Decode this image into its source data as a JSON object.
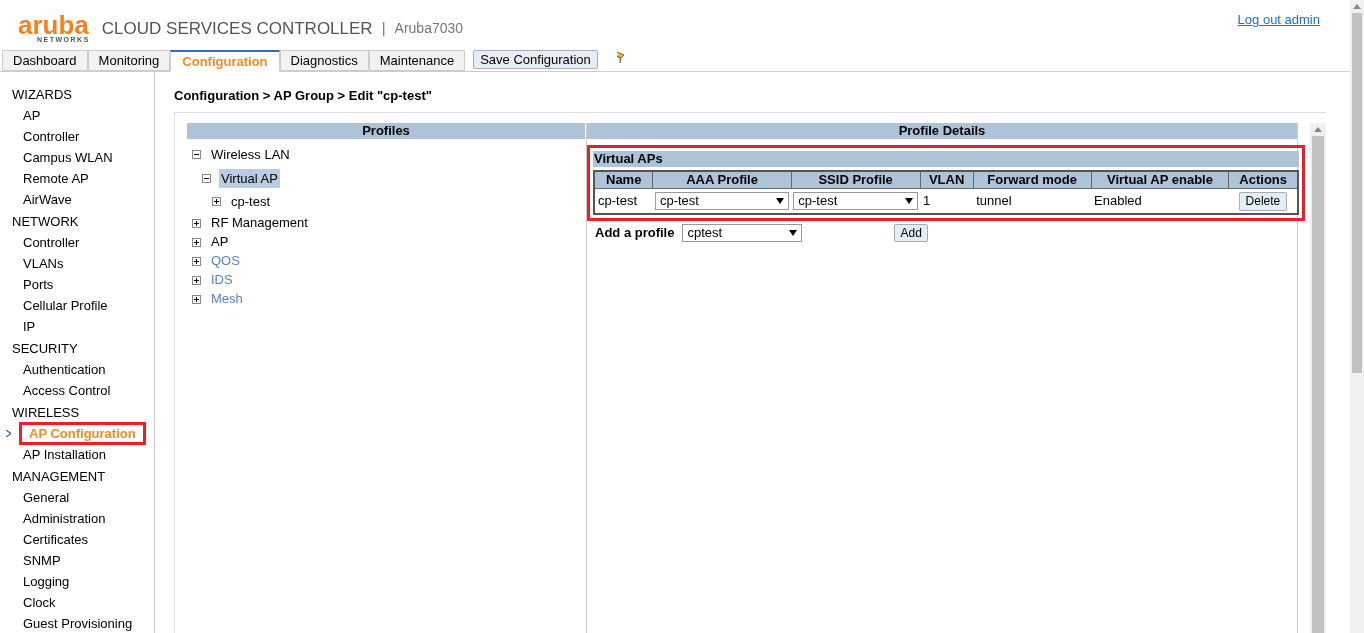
{
  "header": {
    "logo": "aruba",
    "logo_sub": "NETWORKS",
    "title": "CLOUD SERVICES CONTROLLER",
    "separator": "|",
    "device": "Aruba7030",
    "logout": "Log out admin"
  },
  "tabs": [
    {
      "label": "Dashboard",
      "selected": false
    },
    {
      "label": "Monitoring",
      "selected": false
    },
    {
      "label": "Configuration",
      "selected": true
    },
    {
      "label": "Diagnostics",
      "selected": false
    },
    {
      "label": "Maintenance",
      "selected": false
    }
  ],
  "save_button": "Save Configuration",
  "sidebar": {
    "sections": [
      {
        "title": "WIZARDS",
        "items": [
          {
            "label": "AP",
            "selected": false,
            "highlighted": false
          },
          {
            "label": "Controller",
            "selected": false,
            "highlighted": false
          },
          {
            "label": "Campus WLAN",
            "selected": false,
            "highlighted": false
          },
          {
            "label": "Remote AP",
            "selected": false,
            "highlighted": false
          },
          {
            "label": "AirWave",
            "selected": false,
            "highlighted": false
          }
        ]
      },
      {
        "title": "NETWORK",
        "items": [
          {
            "label": "Controller",
            "selected": false,
            "highlighted": false
          },
          {
            "label": "VLANs",
            "selected": false,
            "highlighted": false
          },
          {
            "label": "Ports",
            "selected": false,
            "highlighted": false
          },
          {
            "label": "Cellular Profile",
            "selected": false,
            "highlighted": false
          },
          {
            "label": "IP",
            "selected": false,
            "highlighted": false
          }
        ]
      },
      {
        "title": "SECURITY",
        "items": [
          {
            "label": "Authentication",
            "selected": false,
            "highlighted": false
          },
          {
            "label": "Access Control",
            "selected": false,
            "highlighted": false
          }
        ]
      },
      {
        "title": "WIRELESS",
        "items": [
          {
            "label": "AP Configuration",
            "selected": true,
            "highlighted": true
          },
          {
            "label": "AP Installation",
            "selected": false,
            "highlighted": false
          }
        ]
      },
      {
        "title": "MANAGEMENT",
        "items": [
          {
            "label": "General",
            "selected": false,
            "highlighted": false
          },
          {
            "label": "Administration",
            "selected": false,
            "highlighted": false
          },
          {
            "label": "Certificates",
            "selected": false,
            "highlighted": false
          },
          {
            "label": "SNMP",
            "selected": false,
            "highlighted": false
          },
          {
            "label": "Logging",
            "selected": false,
            "highlighted": false
          },
          {
            "label": "Clock",
            "selected": false,
            "highlighted": false
          },
          {
            "label": "Guest Provisioning",
            "selected": false,
            "highlighted": false
          }
        ]
      }
    ]
  },
  "breadcrumb": "Configuration > AP Group > Edit \"cp-test\"",
  "profiles": {
    "header": "Profiles",
    "tree": [
      {
        "label": "Wireless LAN",
        "expanded": true,
        "selected": false,
        "linked": false,
        "children": [
          {
            "label": "Virtual AP",
            "expanded": true,
            "selected": true,
            "linked": false,
            "children": [
              {
                "label": "cp-test",
                "expanded": false,
                "selected": false,
                "linked": false
              }
            ]
          }
        ]
      },
      {
        "label": "RF Management",
        "expanded": false,
        "selected": false,
        "linked": false
      },
      {
        "label": "AP",
        "expanded": false,
        "selected": false,
        "linked": false
      },
      {
        "label": "QOS",
        "expanded": false,
        "selected": false,
        "linked": true
      },
      {
        "label": "IDS",
        "expanded": false,
        "selected": false,
        "linked": true
      },
      {
        "label": "Mesh",
        "expanded": false,
        "selected": false,
        "linked": true
      }
    ]
  },
  "details": {
    "header": "Profile Details",
    "section": {
      "title": "Virtual APs",
      "highlighted": true,
      "columns": [
        "Name",
        "AAA Profile",
        "SSID Profile",
        "VLAN",
        "Forward mode",
        "Virtual AP enable",
        "Actions"
      ],
      "rows": [
        {
          "name": "cp-test",
          "aaa_profile": "cp-test",
          "ssid_profile": "cp-test",
          "vlan": "1",
          "forward_mode": "tunnel",
          "enable": "Enabled",
          "action": "Delete"
        }
      ]
    },
    "add_label": "Add a profile",
    "add_select": "cptest",
    "add_button": "Add"
  }
}
